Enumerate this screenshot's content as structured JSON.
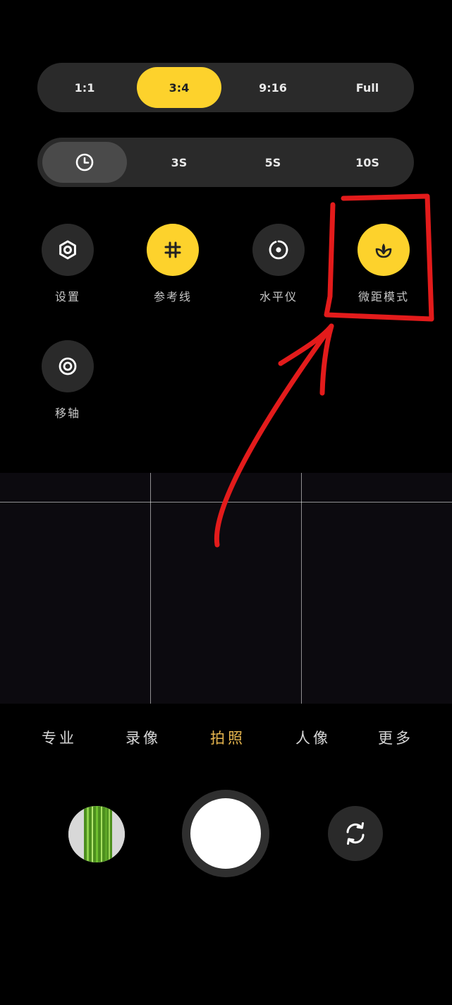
{
  "aspect_ratio": {
    "options": [
      "1:1",
      "3:4",
      "9:16",
      "Full"
    ],
    "selected": "3:4"
  },
  "timer": {
    "options": [
      "3S",
      "5S",
      "10S"
    ],
    "off_icon": "clock-icon"
  },
  "tools": [
    {
      "label": "设置",
      "icon": "gear-icon",
      "active": false
    },
    {
      "label": "参考线",
      "icon": "grid-icon",
      "active": true
    },
    {
      "label": "水平仪",
      "icon": "level-icon",
      "active": false
    },
    {
      "label": "微距模式",
      "icon": "macro-flower-icon",
      "active": true
    },
    {
      "label": "移轴",
      "icon": "tilt-shift-icon",
      "active": false
    }
  ],
  "modes": [
    "专业",
    "录像",
    "拍照",
    "人像",
    "更多"
  ],
  "active_mode": "拍照",
  "colors": {
    "accent_yellow": "#fdd22c",
    "active_mode": "#e7b64e",
    "annotation_red": "#e31b1b"
  }
}
